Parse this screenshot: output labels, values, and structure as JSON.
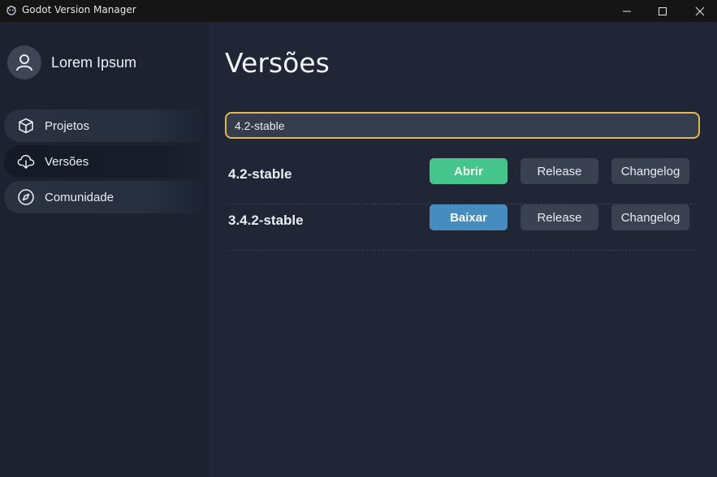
{
  "window": {
    "title": "Godot Version Manager"
  },
  "sidebar": {
    "user_name": "Lorem Ipsum",
    "items": [
      {
        "label": "Projetos",
        "icon": "cube-icon",
        "active": false
      },
      {
        "label": "Versões",
        "icon": "cloud-download-icon",
        "active": true
      },
      {
        "label": "Comunidade",
        "icon": "compass-icon",
        "active": false
      }
    ]
  },
  "main": {
    "title": "Versões",
    "search": {
      "value": "4.2-stable",
      "placeholder": ""
    },
    "versions": [
      {
        "name": "4.2-stable",
        "primary_label": "Abrir",
        "primary_color": "#45c48b",
        "release_label": "Release",
        "changelog_label": "Changelog"
      },
      {
        "name": "3.4.2-stable",
        "primary_label": "Baixar",
        "primary_color": "#478cbf",
        "release_label": "Release",
        "changelog_label": "Changelog"
      }
    ]
  },
  "colors": {
    "accent_focus": "#e6b84a",
    "open_green": "#45c48b",
    "download_blue": "#478cbf"
  }
}
